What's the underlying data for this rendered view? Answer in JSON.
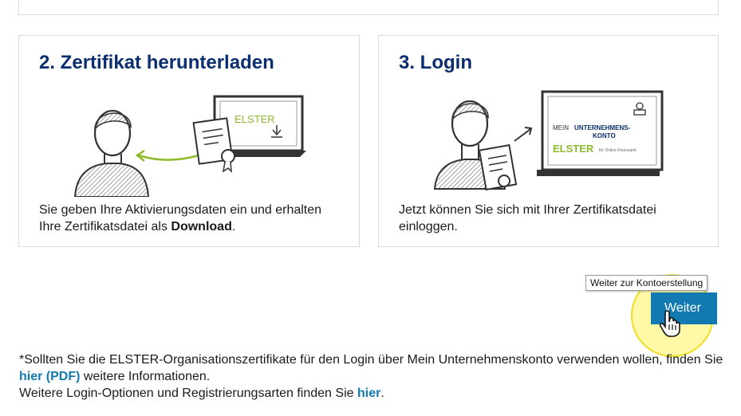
{
  "card2": {
    "title": "2. Zertifikat herunterladen",
    "illustration": {
      "screen_text": "ELSTER"
    },
    "text_before": "Sie geben Ihre Aktivierungsdaten ein und erhalten Ihre Zertifikatsdatei als ",
    "text_bold": "Download",
    "text_after": "."
  },
  "card3": {
    "title": "3. Login",
    "illustration": {
      "line1_prefix": "MEIN",
      "line1_bold": "UNTERNEHMENS-",
      "line2": "KONTO",
      "elster": "ELSTER",
      "elster_sub": "Ihr Online-Finanzamt"
    },
    "text": "Jetzt können Sie sich mit Ihrer Zertifikatsdatei einloggen."
  },
  "tooltip": "Weiter zur Kontoerstellung",
  "weiter_button": "Weiter",
  "footer": {
    "line1": "*Sollten Sie die ELSTER-Organisationszertifikate für den Login über Mein Unternehmenskonto verwenden wollen, finden Sie ",
    "link1": "hier (PDF)",
    "line1_end": " weitere Informationen.",
    "line2": "Weitere Login-Optionen und Registrierungsarten finden Sie ",
    "link2": "hier",
    "line2_end": "."
  },
  "colors": {
    "title": "#0a2e6e",
    "accent_blue": "#127ab1",
    "elster_green": "#8dbb2c"
  }
}
